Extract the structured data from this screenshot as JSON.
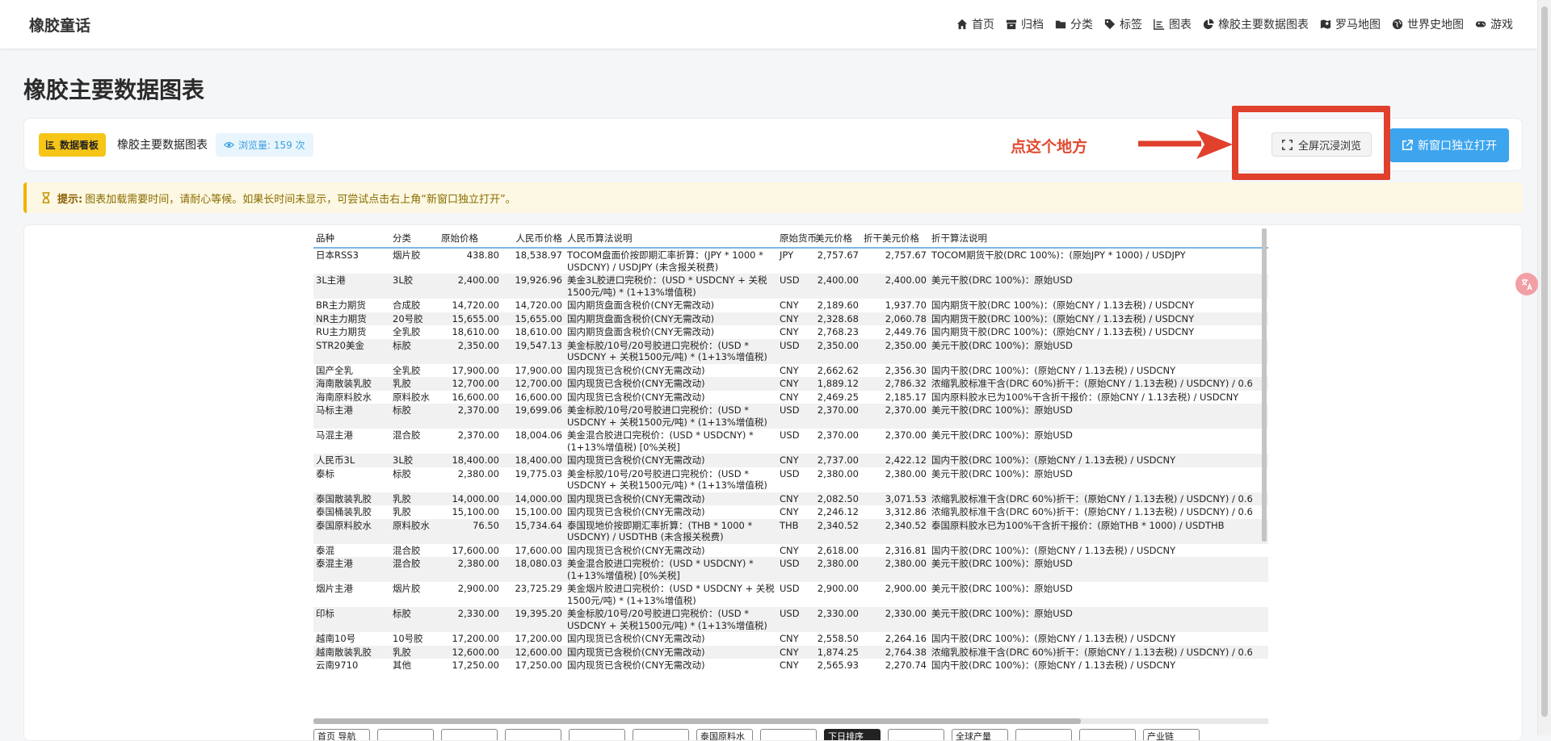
{
  "brand": "橡胶童话",
  "nav": [
    {
      "label": "首页",
      "icon": "home-icon"
    },
    {
      "label": "归档",
      "icon": "archive-icon"
    },
    {
      "label": "分类",
      "icon": "folder-icon"
    },
    {
      "label": "标签",
      "icon": "tag-icon"
    },
    {
      "label": "图表",
      "icon": "chart-icon"
    },
    {
      "label": "橡胶主要数据图表",
      "icon": "pie-chart-icon"
    },
    {
      "label": "罗马地图",
      "icon": "map-icon"
    },
    {
      "label": "世界史地图",
      "icon": "globe-icon"
    },
    {
      "label": "游戏",
      "icon": "gamepad-icon"
    }
  ],
  "page_title": "橡胶主要数据图表",
  "header": {
    "badge": "数据看板",
    "title": "橡胶主要数据图表",
    "views": "浏览量: 159 次",
    "annotation": "点这个地方",
    "fullscreen_label": "全屏沉浸浏览",
    "newwindow_label": "新窗口独立打开"
  },
  "tip": {
    "label": "提示:",
    "text": "图表加载需要时间，请耐心等候。如果长时间未显示，可尝试点击右上角“新窗口独立打开”。"
  },
  "table": {
    "headers": [
      "品种",
      "分类",
      "原始价格",
      "人民币价格",
      "人民币算法说明",
      "原始货币",
      "美元价格",
      "折干美元价格",
      "折干算法说明"
    ],
    "rows": [
      [
        "日本RSS3",
        "烟片胶",
        "438.80",
        "18,538.97",
        "TOCOM盘面价按即期汇率折算：(JPY * 1000 * USDCNY) / USDJPY (未含报关税费)",
        "JPY",
        "2,757.67",
        "2,757.67",
        "TOCOM期货干胶(DRC 100%)：(原始JPY * 1000) / USDJPY"
      ],
      [
        "3L主港",
        "3L胶",
        "2,400.00",
        "19,926.96",
        "美金3L胶进口完税价：(USD * USDCNY + 关税1500元/吨) * (1+13%增值税)",
        "USD",
        "2,400.00",
        "2,400.00",
        "美元干胶(DRC 100%)：原始USD"
      ],
      [
        "BR主力期货",
        "合成胶",
        "14,720.00",
        "14,720.00",
        "国内期货盘面含税价(CNY无需改动)",
        "CNY",
        "2,189.60",
        "1,937.70",
        "国内期货干胶(DRC 100%)：(原始CNY / 1.13去税) / USDCNY"
      ],
      [
        "NR主力期货",
        "20号胶",
        "15,655.00",
        "15,655.00",
        "国内期货盘面含税价(CNY无需改动)",
        "CNY",
        "2,328.68",
        "2,060.78",
        "国内期货干胶(DRC 100%)：(原始CNY / 1.13去税) / USDCNY"
      ],
      [
        "RU主力期货",
        "全乳胶",
        "18,610.00",
        "18,610.00",
        "国内期货盘面含税价(CNY无需改动)",
        "CNY",
        "2,768.23",
        "2,449.76",
        "国内期货干胶(DRC 100%)：(原始CNY / 1.13去税) / USDCNY"
      ],
      [
        "STR20美金",
        "标胶",
        "2,350.00",
        "19,547.13",
        "美金标胶/10号/20号胶进口完税价：(USD * USDCNY + 关税1500元/吨) * (1+13%增值税)",
        "USD",
        "2,350.00",
        "2,350.00",
        "美元干胶(DRC 100%)：原始USD"
      ],
      [
        "国产全乳",
        "全乳胶",
        "17,900.00",
        "17,900.00",
        "国内现货已含税价(CNY无需改动)",
        "CNY",
        "2,662.62",
        "2,356.30",
        "国内干胶(DRC 100%)：(原始CNY / 1.13去税) / USDCNY"
      ],
      [
        "海南散装乳胶",
        "乳胶",
        "12,700.00",
        "12,700.00",
        "国内现货已含税价(CNY无需改动)",
        "CNY",
        "1,889.12",
        "2,786.32",
        "浓缩乳胶标准干含(DRC 60%)折干：(原始CNY / 1.13去税) / USDCNY) / 0.6"
      ],
      [
        "海南原料胶水",
        "原料胶水",
        "16,600.00",
        "16,600.00",
        "国内现货已含税价(CNY无需改动)",
        "CNY",
        "2,469.25",
        "2,185.17",
        "国内原料胶水已为100%干含折干报价：(原始CNY / 1.13去税) / USDCNY"
      ],
      [
        "马标主港",
        "标胶",
        "2,370.00",
        "19,699.06",
        "美金标胶/10号/20号胶进口完税价：(USD * USDCNY + 关税1500元/吨) * (1+13%增值税)",
        "USD",
        "2,370.00",
        "2,370.00",
        "美元干胶(DRC 100%)：原始USD"
      ],
      [
        "马混主港",
        "混合胶",
        "2,370.00",
        "18,004.06",
        "美金混合胶进口完税价：(USD * USDCNY) * (1+13%增值税) [0%关税]",
        "USD",
        "2,370.00",
        "2,370.00",
        "美元干胶(DRC 100%)：原始USD"
      ],
      [
        "人民币3L",
        "3L胶",
        "18,400.00",
        "18,400.00",
        "国内现货已含税价(CNY无需改动)",
        "CNY",
        "2,737.00",
        "2,422.12",
        "国内干胶(DRC 100%)：(原始CNY / 1.13去税) / USDCNY"
      ],
      [
        "泰标",
        "标胶",
        "2,380.00",
        "19,775.03",
        "美金标胶/10号/20号胶进口完税价：(USD * USDCNY + 关税1500元/吨) * (1+13%增值税)",
        "USD",
        "2,380.00",
        "2,380.00",
        "美元干胶(DRC 100%)：原始USD"
      ],
      [
        "泰国散装乳胶",
        "乳胶",
        "14,000.00",
        "14,000.00",
        "国内现货已含税价(CNY无需改动)",
        "CNY",
        "2,082.50",
        "3,071.53",
        "浓缩乳胶标准干含(DRC 60%)折干：(原始CNY / 1.13去税) / USDCNY) / 0.6"
      ],
      [
        "泰国桶装乳胶",
        "乳胶",
        "15,100.00",
        "15,100.00",
        "国内现货已含税价(CNY无需改动)",
        "CNY",
        "2,246.12",
        "3,312.86",
        "浓缩乳胶标准干含(DRC 60%)折干：(原始CNY / 1.13去税) / USDCNY) / 0.6"
      ],
      [
        "泰国原料胶水",
        "原料胶水",
        "76.50",
        "15,734.64",
        "泰国现地价按即期汇率折算：(THB * 1000 * USDCNY) / USDTHB (未含报关税费)",
        "THB",
        "2,340.52",
        "2,340.52",
        "泰国原料胶水已为100%干含折干报价：(原始THB * 1000) / USDTHB"
      ],
      [
        "泰混",
        "混合胶",
        "17,600.00",
        "17,600.00",
        "国内现货已含税价(CNY无需改动)",
        "CNY",
        "2,618.00",
        "2,316.81",
        "国内干胶(DRC 100%)：(原始CNY / 1.13去税) / USDCNY"
      ],
      [
        "泰混主港",
        "混合胶",
        "2,380.00",
        "18,080.03",
        "美金混合胶进口完税价：(USD * USDCNY) * (1+13%增值税) [0%关税]",
        "USD",
        "2,380.00",
        "2,380.00",
        "美元干胶(DRC 100%)：原始USD"
      ],
      [
        "烟片主港",
        "烟片胶",
        "2,900.00",
        "23,725.29",
        "美金烟片胶进口完税价：(USD * USDCNY + 关税1500元/吨) * (1+13%增值税)",
        "USD",
        "2,900.00",
        "2,900.00",
        "美元干胶(DRC 100%)：原始USD"
      ],
      [
        "印标",
        "标胶",
        "2,330.00",
        "19,395.20",
        "美金标胶/10号/20号胶进口完税价：(USD * USDCNY + 关税1500元/吨) * (1+13%增值税)",
        "USD",
        "2,330.00",
        "2,330.00",
        "美元干胶(DRC 100%)：原始USD"
      ],
      [
        "越南10号",
        "10号胶",
        "17,200.00",
        "17,200.00",
        "国内现货已含税价(CNY无需改动)",
        "CNY",
        "2,558.50",
        "2,264.16",
        "国内干胶(DRC 100%)：(原始CNY / 1.13去税) / USDCNY"
      ],
      [
        "越南散装乳胶",
        "乳胶",
        "12,600.00",
        "12,600.00",
        "国内现货已含税价(CNY无需改动)",
        "CNY",
        "1,874.25",
        "2,764.38",
        "浓缩乳胶标准干含(DRC 60%)折干：(原始CNY / 1.13去税) / USDCNY) / 0.6"
      ],
      [
        "云南9710",
        "其他",
        "17,250.00",
        "17,250.00",
        "国内现货已含税价(CNY无需改动)",
        "CNY",
        "2,565.93",
        "2,270.74",
        "国内干胶(DRC 100%)：(原始CNY / 1.13去税) / USDCNY"
      ]
    ]
  },
  "filters": [
    "首页 导航",
    "",
    "",
    "",
    "",
    "",
    "泰国原料水",
    "",
    "下日排序",
    "",
    "全球产量",
    "",
    "",
    "产业链"
  ],
  "colors": {
    "accent": "#3da5ee",
    "annotation": "#e0402c",
    "badge": "#f5c518"
  }
}
